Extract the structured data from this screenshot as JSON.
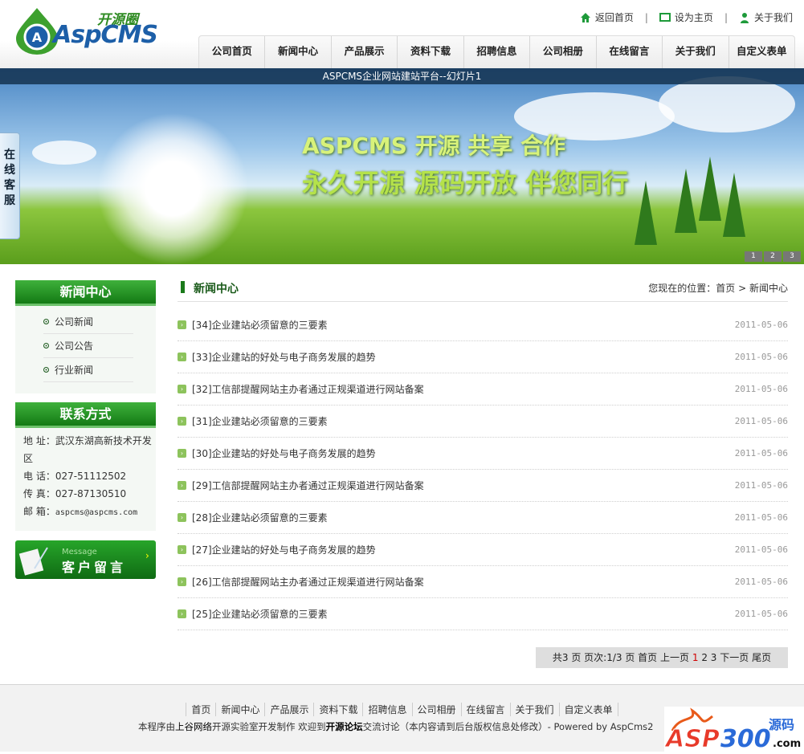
{
  "header": {
    "logo_cn": "开源圈",
    "logo_en": "AspCMS",
    "top_links": [
      {
        "label": "返回首页",
        "icon": "home-icon"
      },
      {
        "label": "设为主页",
        "icon": "monitor-icon"
      },
      {
        "label": "关于我们",
        "icon": "user-icon"
      }
    ],
    "nav": [
      "公司首页",
      "新闻中心",
      "产品展示",
      "资料下载",
      "招聘信息",
      "公司相册",
      "在线留言",
      "关于我们",
      "自定义表单"
    ]
  },
  "banner": {
    "caption": "ASPCMS企业网站建站平台--幻灯片1",
    "slogan1": "ASPCMS 开源  共享  合作",
    "slogan2": "永久开源 源码开放  伴您同行",
    "slides": [
      "1",
      "2",
      "3"
    ]
  },
  "float_service": "在线客服",
  "sidebar": {
    "news_title": "新闻中心",
    "news_items": [
      "公司新闻",
      "公司公告",
      "行业新闻"
    ],
    "contact_title": "联系方式",
    "contact": [
      {
        "label": "地 址：",
        "value": "武汉东湖高新技术开发区"
      },
      {
        "label": "电 话：",
        "value": "027-51112502"
      },
      {
        "label": "传 真：",
        "value": "027-87130510"
      },
      {
        "label": "邮 箱：",
        "value": "aspcms@aspcms.com"
      }
    ],
    "message_en": "Message",
    "message_cn": "客户留言"
  },
  "main": {
    "title": "新闻中心",
    "breadcrumb_prefix": "您现在的位置：",
    "breadcrumb": [
      "首页",
      "新闻中心"
    ],
    "articles": [
      {
        "title": "[34]企业建站必须留意的三要素",
        "date": "2011-05-06"
      },
      {
        "title": "[33]企业建站的好处与电子商务发展的趋势",
        "date": "2011-05-06"
      },
      {
        "title": "[32]工信部提醒网站主办者通过正规渠道进行网站备案",
        "date": "2011-05-06"
      },
      {
        "title": "[31]企业建站必须留意的三要素",
        "date": "2011-05-06"
      },
      {
        "title": "[30]企业建站的好处与电子商务发展的趋势",
        "date": "2011-05-06"
      },
      {
        "title": "[29]工信部提醒网站主办者通过正规渠道进行网站备案",
        "date": "2011-05-06"
      },
      {
        "title": "[28]企业建站必须留意的三要素",
        "date": "2011-05-06"
      },
      {
        "title": "[27]企业建站的好处与电子商务发展的趋势",
        "date": "2011-05-06"
      },
      {
        "title": "[26]工信部提醒网站主办者通过正规渠道进行网站备案",
        "date": "2011-05-06"
      },
      {
        "title": "[25]企业建站必须留意的三要素",
        "date": "2011-05-06"
      }
    ],
    "pager": {
      "total": "共3 页",
      "current": "页次:1/3 页",
      "first": "首页",
      "prev": "上一页",
      "pages": [
        "1",
        "2",
        "3"
      ],
      "next": "下一页",
      "last": "尾页",
      "active_color": "#d00000"
    }
  },
  "footer": {
    "links": [
      "首页",
      "新闻中心",
      "产品展示",
      "资料下载",
      "招聘信息",
      "公司相册",
      "在线留言",
      "关于我们",
      "自定义表单"
    ],
    "copy_a": "本程序由",
    "copy_b": "上谷网络",
    "copy_c": "开源实验室开发制作 欢迎到",
    "copy_d": "开源论坛",
    "copy_e": "交流讨论（本内容请到后台版权信息处修改）- Powered by AspCms2",
    "watermark": "ASP300源码.com"
  }
}
